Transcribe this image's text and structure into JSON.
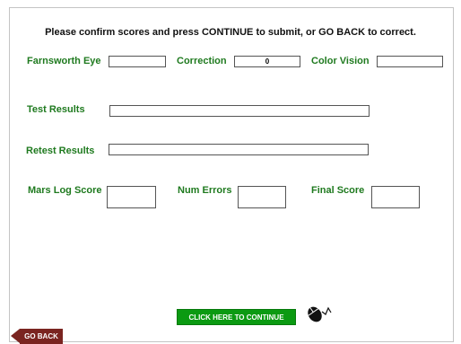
{
  "instructions": "Please confirm scores and press CONTINUE to submit, or GO BACK to correct.",
  "fields": {
    "farnsworth_eye": {
      "label": "Farnsworth Eye",
      "value": ""
    },
    "correction": {
      "label": "Correction",
      "value": "0"
    },
    "color_vision": {
      "label": "Color Vision",
      "value": ""
    },
    "test_results": {
      "label": "Test Results",
      "value": ""
    },
    "retest_results": {
      "label": "Retest Results",
      "value": ""
    },
    "mars_log_score": {
      "label": "Mars Log Score",
      "value": ""
    },
    "num_errors": {
      "label": "Num Errors",
      "value": ""
    },
    "final_score": {
      "label": "Final Score",
      "value": ""
    }
  },
  "buttons": {
    "continue_label": "CLICK HERE TO CONTINUE",
    "go_back_label": "GO BACK"
  },
  "icons": {
    "mouse": "mouse-click-icon"
  },
  "colors": {
    "label_green": "#1f7a1f",
    "continue_green": "#0b9a12",
    "back_red": "#7a2420"
  }
}
